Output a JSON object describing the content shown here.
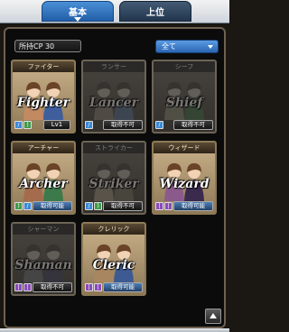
{
  "tabs": {
    "basic": "基本",
    "advanced": "上位"
  },
  "cp": "所持CP 30",
  "filter": {
    "selected": "全て"
  },
  "cards": [
    {
      "header": "ファイター",
      "title": "Fighter",
      "state": "unlocked",
      "level": "Lv1",
      "icons": [
        "sword",
        "bow"
      ],
      "palette": [
        "#c38a62",
        "#3e5e9c"
      ]
    },
    {
      "header": "ランサー",
      "title": "Lancer",
      "state": "locked",
      "status": "取得不可",
      "icons": [
        "sword"
      ],
      "palette": [
        "#7a7468",
        "#5c6a7c"
      ]
    },
    {
      "header": "シーフ",
      "title": "Shief",
      "state": "locked",
      "status": "取得不可",
      "icons": [
        "sword"
      ],
      "palette": [
        "#7d7b6a",
        "#4e6a4c"
      ]
    },
    {
      "header": "アーチャー",
      "title": "Archer",
      "state": "available",
      "status": "取得可能",
      "icons": [
        "bow",
        "sword"
      ],
      "palette": [
        "#a46c4c",
        "#3d7a4b"
      ]
    },
    {
      "header": "ストライカー",
      "title": "Striker",
      "state": "locked",
      "status": "取得不可",
      "icons": [
        "sword",
        "bow"
      ],
      "palette": [
        "#8c8272",
        "#6e6a5c"
      ]
    },
    {
      "header": "ウィザード",
      "title": "Wizard",
      "state": "available",
      "status": "取得可能",
      "icons": [
        "staff",
        "staff"
      ],
      "palette": [
        "#8a5a8c",
        "#3a2a4e"
      ]
    },
    {
      "header": "シャーマン",
      "title": "Shaman",
      "state": "locked",
      "status": "取得不可",
      "icons": [
        "staff",
        "staff"
      ],
      "palette": [
        "#6a6a6c",
        "#4e4a58"
      ]
    },
    {
      "header": "クレリック",
      "title": "Cleric",
      "state": "available",
      "status": "取得可能",
      "icons": [
        "staff",
        "staff"
      ],
      "palette": [
        "#a88660",
        "#3e5a92"
      ]
    }
  ],
  "colors": {
    "tab_active": "#2d6cba",
    "tab_inactive": "#2a3e58",
    "filter_bg": "#3b7bd0",
    "panel_border": "#6e6250"
  }
}
